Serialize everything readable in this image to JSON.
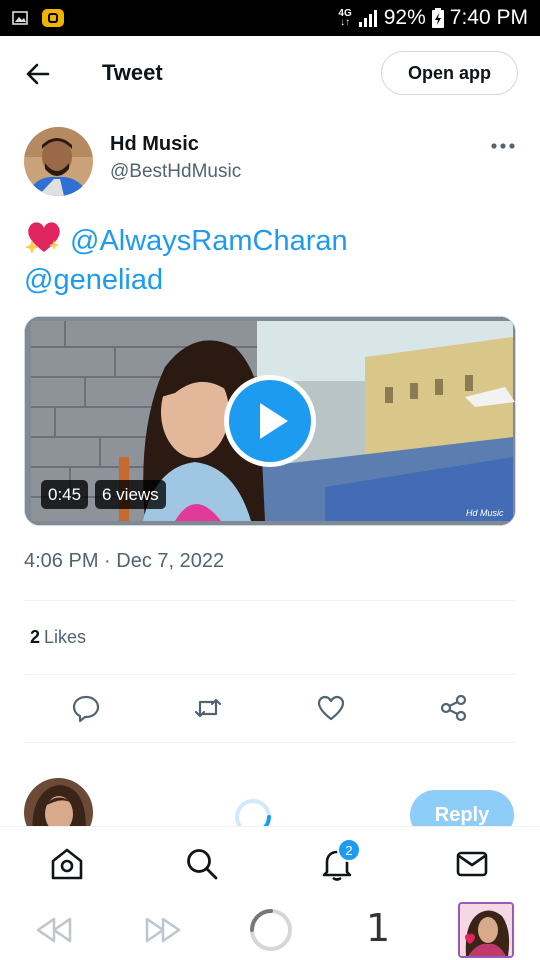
{
  "status_bar": {
    "network": "4G",
    "battery": "92%",
    "time": "7:40 PM",
    "icons": [
      "gallery-icon",
      "notification-app-icon",
      "signal-icon",
      "battery-charging-icon"
    ]
  },
  "header": {
    "title": "Tweet",
    "open_app_label": "Open app",
    "back_icon": "arrow-left-icon"
  },
  "tweet": {
    "author_name": "Hd Music",
    "author_handle": "@BestHdMusic",
    "emoji": "sparkling-heart",
    "mention_1": "@AlwaysRamCharan",
    "mention_2": "@geneliad",
    "video": {
      "duration": "0:45",
      "views": "6 views",
      "watermark": "Hd Music"
    },
    "timestamp": "4:06 PM · Dec 7, 2022",
    "likes_count": "2",
    "likes_label": "Likes",
    "actions": [
      "reply-icon",
      "retweet-icon",
      "like-icon",
      "share-icon"
    ]
  },
  "reply": {
    "button_label": "Reply"
  },
  "bottom_nav": {
    "items": [
      "home-icon",
      "search-icon",
      "notifications-icon",
      "messages-icon"
    ],
    "notification_count": "2"
  },
  "browser_bar": {
    "tab_count": "1",
    "items": [
      "back-icon",
      "forward-icon",
      "loading-icon",
      "tab-count",
      "tab-thumbnail"
    ]
  },
  "colors": {
    "accent": "#1d9bf0",
    "text": "#0f1419",
    "secondary_text": "#536471",
    "reply_button_disabled": "#8ecdf7"
  }
}
